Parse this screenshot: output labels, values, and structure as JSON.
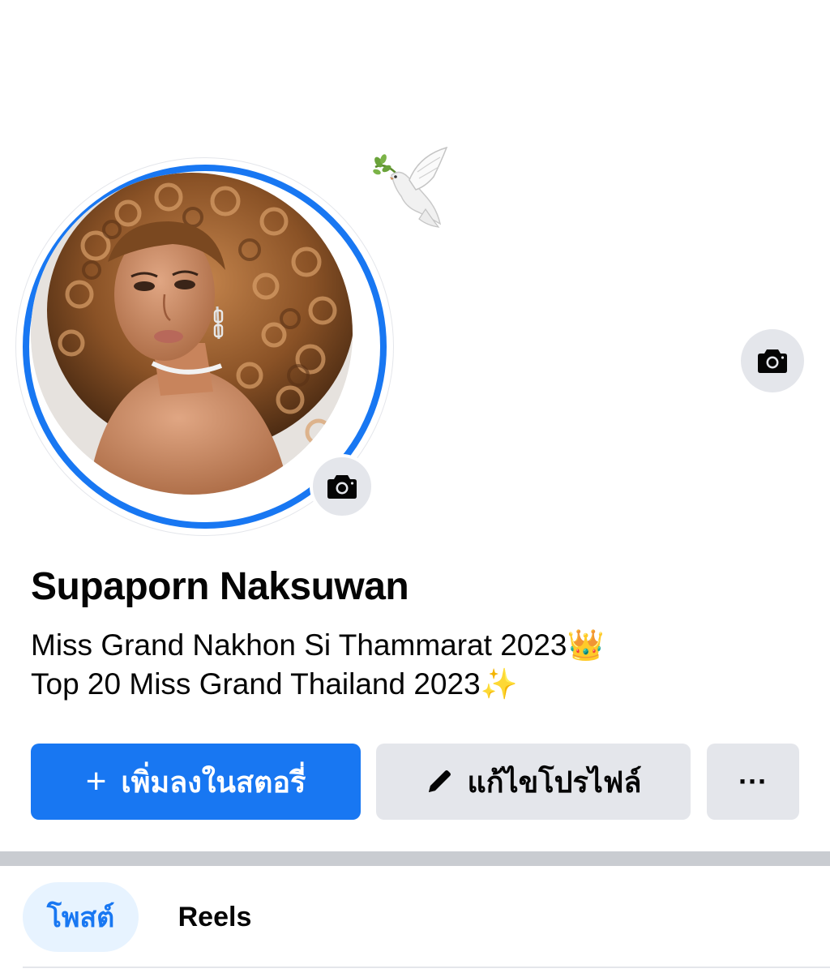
{
  "cover": {
    "sticker_icon": "dove-with-olive-branch-icon",
    "camera_icon": "camera-icon"
  },
  "profile": {
    "name": "Supaporn Naksuwan",
    "bio_line_1": "Miss Grand Nakhon Si Thammarat 2023👑",
    "bio_line_2": "Top 20 Miss Grand Thailand 2023✨",
    "avatar_ring_color": "#1877f2"
  },
  "actions": {
    "add_story_icon": "+",
    "add_story_label": "เพิ่มลงในสตอรี่",
    "edit_profile_label": "แก้ไขโปรไฟล์",
    "more_label": "···"
  },
  "tabs": [
    {
      "label": "โพสต์",
      "active": true
    },
    {
      "label": "Reels",
      "active": false
    }
  ],
  "colors": {
    "accent": "#1877f2",
    "secondary_button": "#e4e6eb",
    "active_tab_bg": "#e7f3ff",
    "divider": "#c9ccd1"
  }
}
